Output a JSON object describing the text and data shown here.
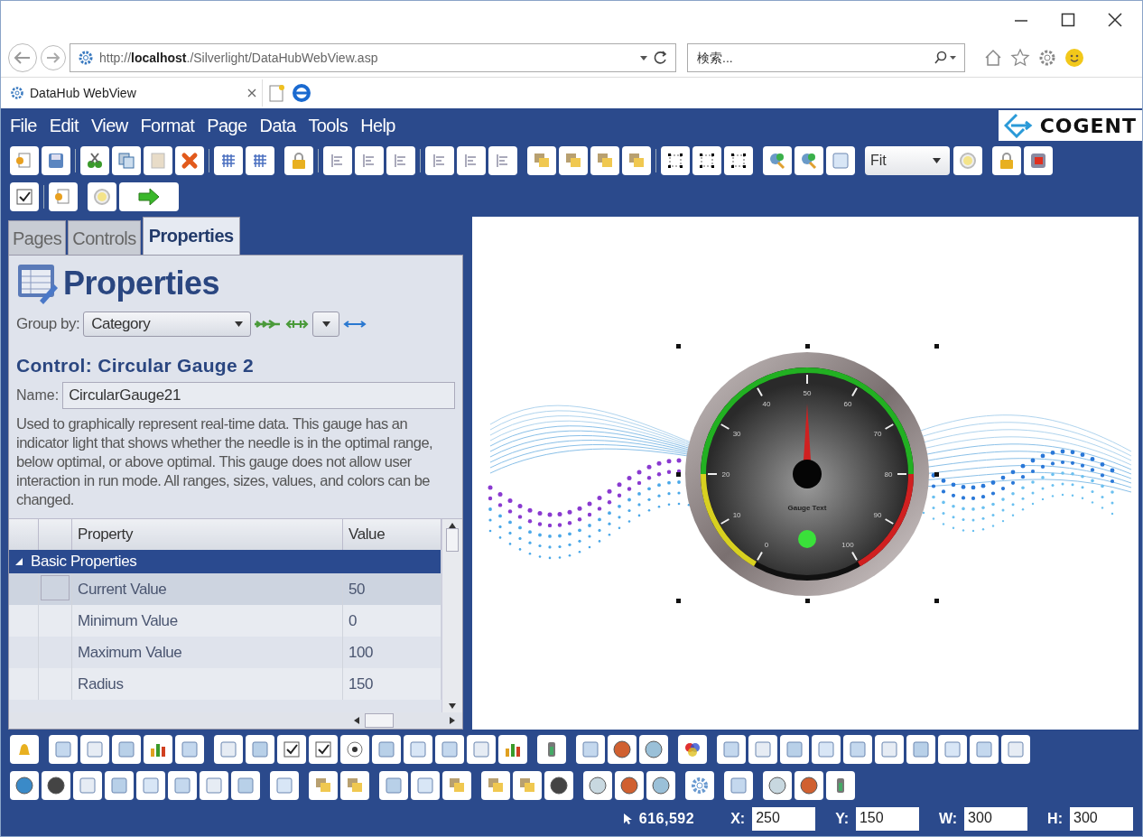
{
  "browser": {
    "address": "http://**localhost**./Silverlight/DataHubWebView.asp",
    "search_placeholder": "検索...",
    "tab_title": "DataHub WebView"
  },
  "menu": [
    "File",
    "Edit",
    "View",
    "Format",
    "Page",
    "Data",
    "Tools",
    "Help"
  ],
  "logo": "COGENT",
  "zoom_select": "Fit",
  "panel_tabs": [
    {
      "label": "Pages",
      "selected": false
    },
    {
      "label": "Controls",
      "selected": false
    },
    {
      "label": "Properties",
      "selected": true
    }
  ],
  "panel_title": "Properties",
  "group_by": {
    "label": "Group by:",
    "value": "Category"
  },
  "control_title": "Control: Circular Gauge 2",
  "name_field": {
    "label": "Name:",
    "value": "CircularGauge21"
  },
  "description": "Used to graphically represent real-time data. This gauge has an indicator light that shows whether the needle is in the optimal range, below optimal, or above optimal. This gauge does not allow user interaction in run mode. All ranges, sizes, values, and colors can be changed.",
  "grid": {
    "columns": [
      "Property",
      "Value"
    ],
    "group": {
      "label": "Basic Properties",
      "expanded": true
    },
    "rows": [
      {
        "property": "Current Value",
        "value": "50",
        "selected": true
      },
      {
        "property": "Minimum Value",
        "value": "0",
        "selected": false
      },
      {
        "property": "Maximum Value",
        "value": "100",
        "selected": false
      },
      {
        "property": "Radius",
        "value": "150",
        "selected": false
      }
    ]
  },
  "gauge": {
    "labels": [
      "0",
      "10",
      "20",
      "30",
      "40",
      "50",
      "60",
      "70",
      "80",
      "90",
      "100"
    ],
    "caption": "Gauge Text",
    "level": 0.5
  },
  "status": {
    "cursor": "616,592",
    "fields": [
      {
        "label": "X:",
        "value": "250"
      },
      {
        "label": "Y:",
        "value": "150"
      },
      {
        "label": "W:",
        "value": "300"
      },
      {
        "label": "H:",
        "value": "300"
      }
    ]
  }
}
